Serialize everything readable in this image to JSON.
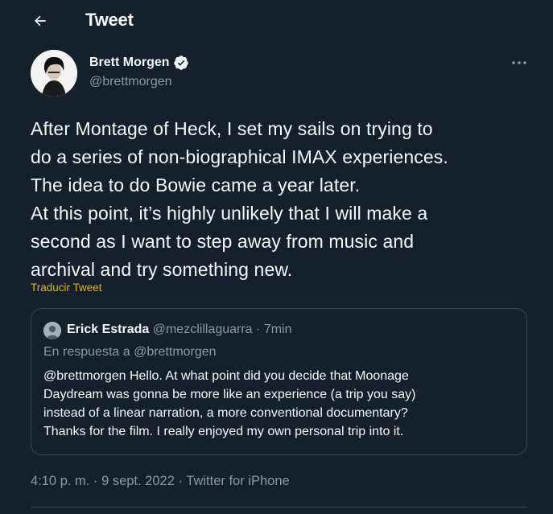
{
  "header": {
    "title": "Tweet",
    "back_icon": "arrow-left-icon"
  },
  "author": {
    "name": "Brett Morgen",
    "handle": "@brettmorgen",
    "verified_icon": "verified-badge-icon"
  },
  "tweet": {
    "text": "After Montage of Heck, I set my sails on trying to\ndo a series of non-biographical IMAX experiences.\nThe idea to do Bowie came a year later.\nAt this point, it’s highly unlikely that I will make a\nsecond as I want to step away from music and\narchival and try something new.",
    "translate_label": "Traducir Tweet",
    "time": "4:10 p. m.",
    "date": "9 sept. 2022",
    "source": "Twitter for iPhone",
    "separator": "·"
  },
  "quoted": {
    "name": "Erick Estrada",
    "handle": "@mezclillaguarra",
    "separator": "·",
    "age": "7min",
    "reply_to": "En respuesta a @brettmorgen",
    "text": "@brettmorgen Hello. At what point did you decide that Moonage\nDaydream was gonna be more like an experience (a trip you say)\ninstead of a linear narration, a more conventional documentary?\nThanks for the film. I really enjoyed my own personal trip into it."
  },
  "colors": {
    "background": "#15202b",
    "text_primary": "#f7f9f9",
    "text_secondary": "#8b98a5",
    "accent_link": "#e0b710",
    "verified_badge": "#f7f9f9",
    "border": "#38444d"
  }
}
